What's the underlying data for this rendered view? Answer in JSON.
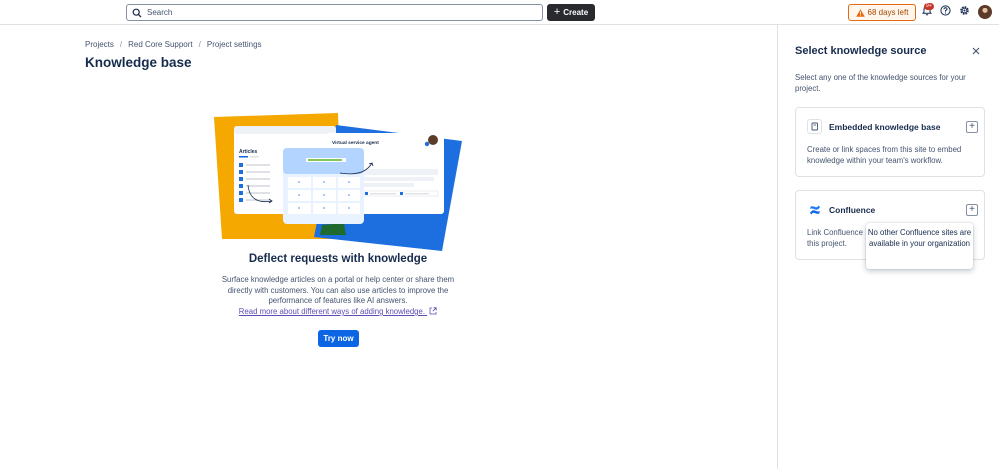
{
  "topbar": {
    "search_placeholder": "Search",
    "create_label": "Create",
    "trial_text": "68 days left",
    "notifications_badge": "9+",
    "icons": [
      "search-icon",
      "plus-icon",
      "warning-icon",
      "bell-icon",
      "help-icon",
      "gear-icon"
    ]
  },
  "breadcrumb": {
    "items": [
      "Projects",
      "Red Core Support",
      "Project settings"
    ],
    "separator": "/"
  },
  "page_title": "Knowledge base",
  "illustration": {
    "panel_left_heading": "Articles",
    "panel_right_heading": "Virtual service agent"
  },
  "empty_state": {
    "title": "Deflect requests with knowledge",
    "description": "Surface knowledge articles on a portal or help center or share them directly with customers. You can also use articles to improve the performance of features like AI answers.",
    "link": "Read more about different ways of adding knowledge.",
    "button": "Try now"
  },
  "side_panel": {
    "title": "Select knowledge source",
    "description": "Select any one of the knowledge sources for your project.",
    "sources": [
      {
        "title": "Embedded knowledge base",
        "description": "Create or link spaces from this site to embed knowledge within your team's workflow.",
        "icon": "book-icon"
      },
      {
        "title": "Confluence",
        "description": "Link Confluence",
        "description_line2": "this project.",
        "icon": "confluence-icon"
      }
    ],
    "tooltip": "No other Confluence sites are available in your organization"
  },
  "colors": {
    "primary": "#0c66e4",
    "create_bg": "#292a2e",
    "warning_border": "#e56910",
    "link": "#5e4db2",
    "badge": "#c9372c",
    "illustration_yellow": "#f5a800",
    "illustration_blue": "#1d6fe0"
  }
}
